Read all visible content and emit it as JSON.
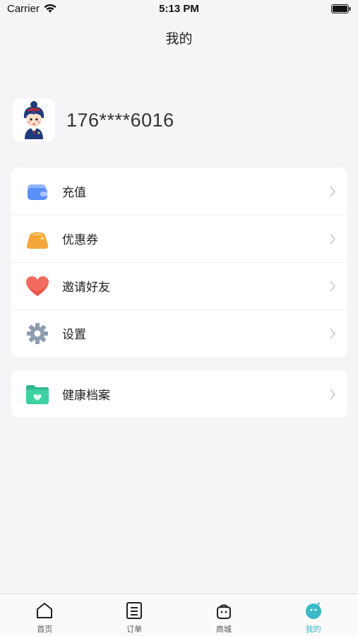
{
  "status_bar": {
    "carrier": "Carrier",
    "time": "5:13 PM"
  },
  "nav": {
    "title": "我的"
  },
  "profile": {
    "phone": "176****6016"
  },
  "menu": {
    "items": [
      {
        "label": "充值",
        "icon": "wallet-icon"
      },
      {
        "label": "优惠券",
        "icon": "coupon-icon"
      },
      {
        "label": "邀请好友",
        "icon": "heart-icon"
      },
      {
        "label": "设置",
        "icon": "gear-icon"
      }
    ]
  },
  "health": {
    "label": "健康档案",
    "icon": "health-folder-icon"
  },
  "tabbar": {
    "items": [
      {
        "label": "首页",
        "icon": "home-icon"
      },
      {
        "label": "订单",
        "icon": "order-icon"
      },
      {
        "label": "商城",
        "icon": "shop-bag-icon"
      },
      {
        "label": "我的",
        "icon": "profile-icon"
      }
    ],
    "active_color": "#3bb9c6"
  }
}
